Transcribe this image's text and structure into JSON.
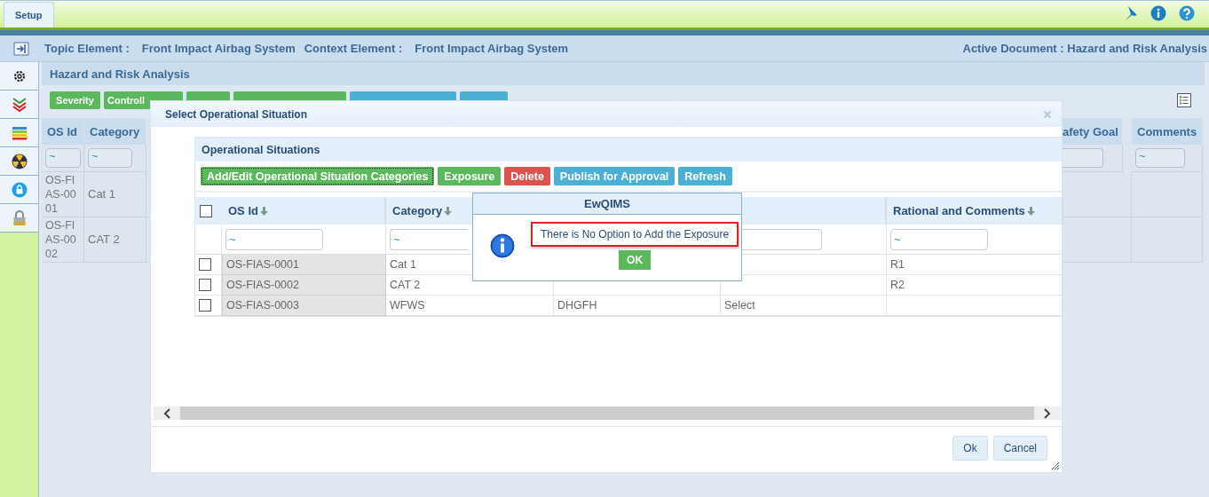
{
  "top_tab": {
    "label": "Setup",
    "selected": true
  },
  "header": {
    "topic_label": "Topic Element :",
    "topic_value": "Front Impact Airbag System",
    "context_label": "Context Element :",
    "context_value": "Front Impact Airbag System",
    "active_document": "Active Document : Hazard and Risk Analysis"
  },
  "panel": {
    "title": "Hazard and Risk Analysis",
    "toolbar": [
      {
        "label": "Severity",
        "kind": "success"
      },
      {
        "label": "Controll",
        "kind": "success"
      },
      {
        "kind": "success"
      },
      {
        "kind": "success"
      },
      {
        "kind": "info"
      },
      {
        "kind": "info"
      }
    ],
    "columns": [
      {
        "label": "OS Id",
        "filter": "~"
      },
      {
        "label": "Category",
        "filter": "~"
      },
      {
        "label": "afety Goal"
      },
      {
        "label": "Comments",
        "filter": "~"
      }
    ],
    "rows": [
      {
        "os_id": "OS-FIAS-0001",
        "category": "Cat 1"
      },
      {
        "os_id": "OS-FIAS-0002",
        "category": "CAT 2"
      }
    ]
  },
  "dialog": {
    "title": "Select Operational Situation",
    "inner_title": "Operational Situations",
    "toolbar": [
      {
        "label": "Add/Edit Operational Situation Categories",
        "kind": "success",
        "focused": true
      },
      {
        "label": "Exposure",
        "kind": "success",
        "focused": false
      },
      {
        "label": "Delete",
        "kind": "danger",
        "focused": false
      },
      {
        "label": "Publish for Approval",
        "kind": "info",
        "focused": false
      },
      {
        "label": "Refresh",
        "kind": "info",
        "focused": false
      }
    ],
    "select_all_checked": false,
    "columns": [
      {
        "label": "OS Id",
        "filter": "~"
      },
      {
        "label": "Category",
        "filter": "~"
      },
      null,
      null,
      {
        "label": "Rational and Comments",
        "filter": "~"
      }
    ],
    "rows": [
      {
        "checked": false,
        "cells": [
          "OS-FIAS-0001",
          "Cat 1",
          null,
          null,
          "R1"
        ]
      },
      {
        "checked": false,
        "cells": [
          "OS-FIAS-0002",
          "CAT 2",
          null,
          null,
          "R2"
        ]
      },
      {
        "checked": false,
        "cells": [
          "OS-FIAS-0003",
          "WFWS",
          "DHGFH",
          "Select",
          null
        ]
      }
    ],
    "buttons": [
      "Ok",
      "Cancel"
    ],
    "message_box": {
      "title": "EwQIMS",
      "message": "There is No Option to Add the Exposure",
      "button": "OK"
    }
  }
}
